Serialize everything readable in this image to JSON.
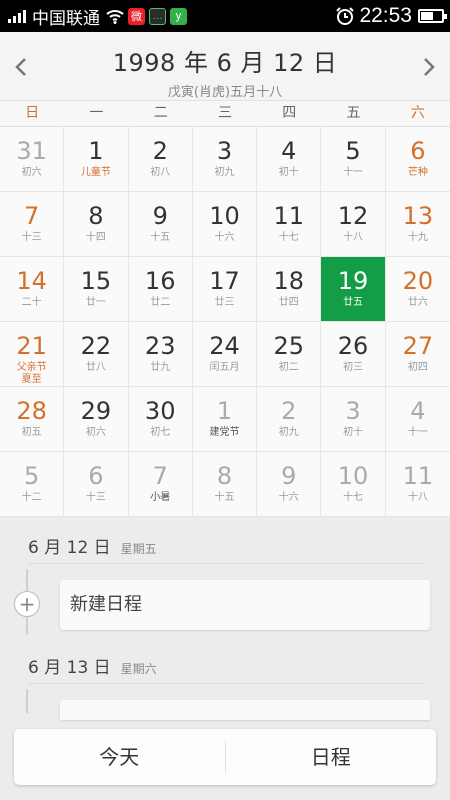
{
  "status_bar": {
    "carrier": "中国联通",
    "time": "22:53",
    "battery_level": 0.55,
    "app_icons": [
      {
        "name": "weibo-icon",
        "glyph": "微"
      },
      {
        "name": "message-icon",
        "glyph": "…"
      },
      {
        "name": "y-app-icon",
        "glyph": "y"
      }
    ]
  },
  "header": {
    "title": "1998 年 6 月 12 日",
    "lunar": "戊寅(肖虎)五月十八"
  },
  "weekdays": [
    "日",
    "一",
    "二",
    "三",
    "四",
    "五",
    "六"
  ],
  "calendar": {
    "selected_index": 19,
    "cells": [
      {
        "day": "31",
        "sub": "初六",
        "other": true
      },
      {
        "day": "1",
        "sub": "儿童节",
        "festival": true
      },
      {
        "day": "2",
        "sub": "初八"
      },
      {
        "day": "3",
        "sub": "初九"
      },
      {
        "day": "4",
        "sub": "初十"
      },
      {
        "day": "5",
        "sub": "十一"
      },
      {
        "day": "6",
        "sub": "芒种",
        "festival": true
      },
      {
        "day": "7",
        "sub": "十三"
      },
      {
        "day": "8",
        "sub": "十四"
      },
      {
        "day": "9",
        "sub": "十五"
      },
      {
        "day": "10",
        "sub": "十六"
      },
      {
        "day": "11",
        "sub": "十七"
      },
      {
        "day": "12",
        "sub": "十八"
      },
      {
        "day": "13",
        "sub": "十九"
      },
      {
        "day": "14",
        "sub": "二十"
      },
      {
        "day": "15",
        "sub": "廿一"
      },
      {
        "day": "16",
        "sub": "廿二"
      },
      {
        "day": "17",
        "sub": "廿三"
      },
      {
        "day": "18",
        "sub": "廿四"
      },
      {
        "day": "19",
        "sub": "廿五"
      },
      {
        "day": "20",
        "sub": "廿六"
      },
      {
        "day": "21",
        "sub": "父亲节",
        "sub2": "夏至",
        "festival": true
      },
      {
        "day": "22",
        "sub": "廿八"
      },
      {
        "day": "23",
        "sub": "廿九"
      },
      {
        "day": "24",
        "sub": "闰五月"
      },
      {
        "day": "25",
        "sub": "初二"
      },
      {
        "day": "26",
        "sub": "初三"
      },
      {
        "day": "27",
        "sub": "初四"
      },
      {
        "day": "28",
        "sub": "初五"
      },
      {
        "day": "29",
        "sub": "初六"
      },
      {
        "day": "30",
        "sub": "初七"
      },
      {
        "day": "1",
        "sub": "建党节",
        "other": true,
        "festival_dark": true
      },
      {
        "day": "2",
        "sub": "初九",
        "other": true
      },
      {
        "day": "3",
        "sub": "初十",
        "other": true
      },
      {
        "day": "4",
        "sub": "十一",
        "other": true
      },
      {
        "day": "5",
        "sub": "十二",
        "other": true
      },
      {
        "day": "6",
        "sub": "十三",
        "other": true
      },
      {
        "day": "7",
        "sub": "小暑",
        "other": true,
        "festival_dark": true
      },
      {
        "day": "8",
        "sub": "十五",
        "other": true
      },
      {
        "day": "9",
        "sub": "十六",
        "other": true
      },
      {
        "day": "10",
        "sub": "十七",
        "other": true
      },
      {
        "day": "11",
        "sub": "十八",
        "other": true
      }
    ]
  },
  "schedule": {
    "day1": {
      "date": "6 月 12 日",
      "weekday": "星期五"
    },
    "new_event_label": "新建日程",
    "day2": {
      "date": "6 月 13 日",
      "weekday": "星期六"
    }
  },
  "bottom_bar": {
    "today_label": "今天",
    "schedule_label": "日程"
  },
  "colors": {
    "accent_green": "#139d46",
    "weekend_orange": "#d4702a"
  }
}
